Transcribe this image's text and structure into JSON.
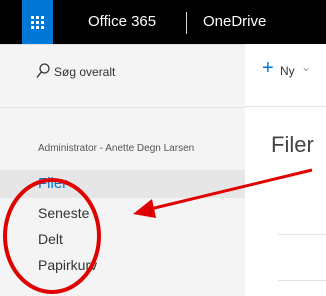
{
  "suitebar": {
    "waffle_icon": "app-launcher-icon",
    "suite_title": "Office 365",
    "app_title": "OneDrive"
  },
  "search": {
    "icon": "search-icon",
    "label": "Søg overalt"
  },
  "leftnav": {
    "user_name": "Administrator - Anette Degn Larsen",
    "items": [
      {
        "label": "Filer",
        "active": true
      },
      {
        "label": "Seneste",
        "active": false
      },
      {
        "label": "Delt",
        "active": false
      },
      {
        "label": "Papirkurv",
        "active": false
      }
    ]
  },
  "commandbar": {
    "new_label": "Ny",
    "new_icon": "plus-icon",
    "chevron_icon": "chevron-down-icon"
  },
  "main": {
    "page_title": "Filer"
  },
  "annotation": {
    "color": "#e00000"
  }
}
